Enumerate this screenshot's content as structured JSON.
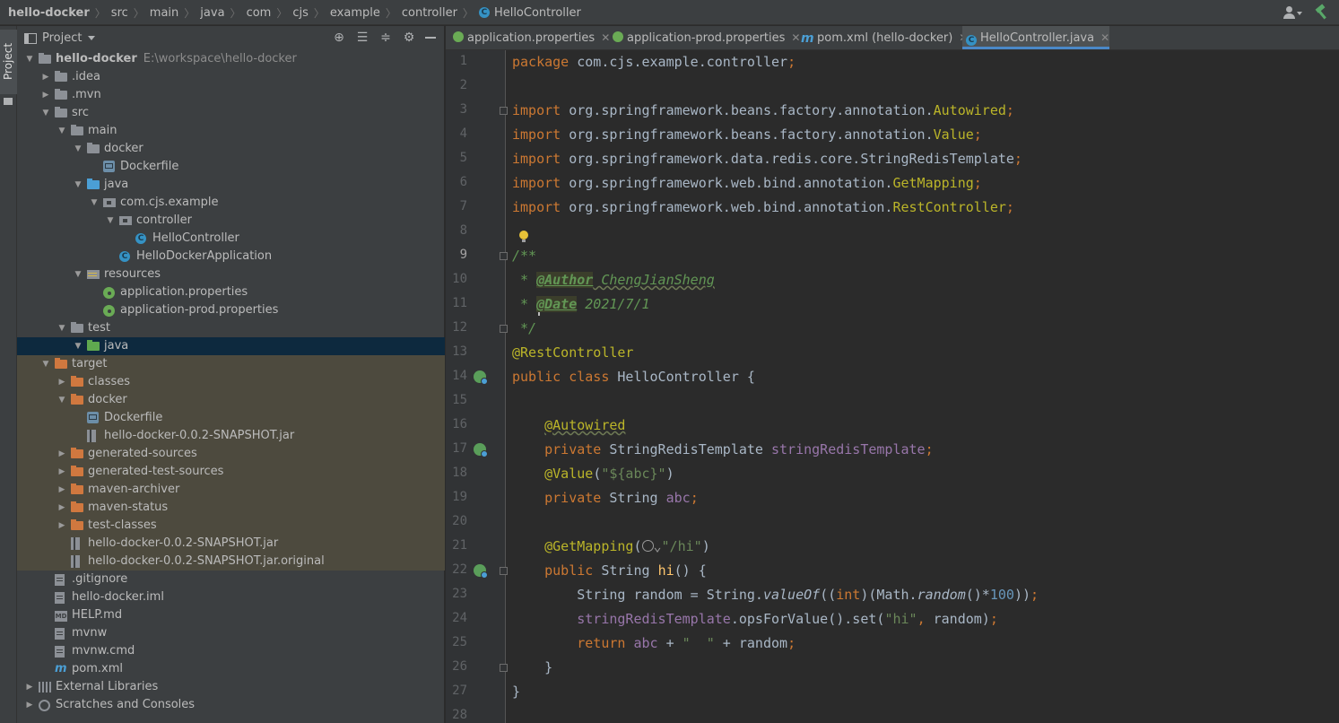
{
  "breadcrumbs": [
    "hello-docker",
    "src",
    "main",
    "java",
    "com",
    "cjs",
    "example",
    "controller",
    "HelloController"
  ],
  "project_panel": {
    "title": "Project"
  },
  "side_stripe": {
    "label": "Project"
  },
  "tree": [
    {
      "depth": 0,
      "arrow": "down",
      "icon": "folder",
      "label": "hello-docker",
      "path": "E:\\workspace\\hello-docker",
      "bold": true
    },
    {
      "depth": 1,
      "arrow": "right",
      "icon": "folder",
      "label": ".idea"
    },
    {
      "depth": 1,
      "arrow": "right",
      "icon": "folder",
      "label": ".mvn"
    },
    {
      "depth": 1,
      "arrow": "down",
      "icon": "folder",
      "label": "src"
    },
    {
      "depth": 2,
      "arrow": "down",
      "icon": "folder",
      "label": "main"
    },
    {
      "depth": 3,
      "arrow": "down",
      "icon": "folder",
      "label": "docker"
    },
    {
      "depth": 4,
      "arrow": "",
      "icon": "docker",
      "label": "Dockerfile"
    },
    {
      "depth": 3,
      "arrow": "down",
      "icon": "src",
      "label": "java"
    },
    {
      "depth": 4,
      "arrow": "down",
      "icon": "pkg",
      "label": "com.cjs.example"
    },
    {
      "depth": 5,
      "arrow": "down",
      "icon": "pkg",
      "label": "controller"
    },
    {
      "depth": 6,
      "arrow": "",
      "icon": "class",
      "label": "HelloController"
    },
    {
      "depth": 5,
      "arrow": "",
      "icon": "class",
      "label": "HelloDockerApplication"
    },
    {
      "depth": 3,
      "arrow": "down",
      "icon": "res",
      "label": "resources"
    },
    {
      "depth": 4,
      "arrow": "",
      "icon": "prop",
      "label": "application.properties"
    },
    {
      "depth": 4,
      "arrow": "",
      "icon": "prop",
      "label": "application-prod.properties"
    },
    {
      "depth": 2,
      "arrow": "down",
      "icon": "folder",
      "label": "test"
    },
    {
      "depth": 3,
      "arrow": "down",
      "icon": "test",
      "label": "java",
      "selected": true
    },
    {
      "depth": 1,
      "arrow": "down",
      "icon": "target",
      "label": "target",
      "excluded": true
    },
    {
      "depth": 2,
      "arrow": "right",
      "icon": "target",
      "label": "classes",
      "excluded": true
    },
    {
      "depth": 2,
      "arrow": "down",
      "icon": "target",
      "label": "docker",
      "excluded": true
    },
    {
      "depth": 3,
      "arrow": "",
      "icon": "docker",
      "label": "Dockerfile",
      "excluded": true
    },
    {
      "depth": 3,
      "arrow": "",
      "icon": "jar",
      "label": "hello-docker-0.0.2-SNAPSHOT.jar",
      "excluded": true
    },
    {
      "depth": 2,
      "arrow": "right",
      "icon": "target",
      "label": "generated-sources",
      "excluded": true
    },
    {
      "depth": 2,
      "arrow": "right",
      "icon": "target",
      "label": "generated-test-sources",
      "excluded": true
    },
    {
      "depth": 2,
      "arrow": "right",
      "icon": "target",
      "label": "maven-archiver",
      "excluded": true
    },
    {
      "depth": 2,
      "arrow": "right",
      "icon": "target",
      "label": "maven-status",
      "excluded": true
    },
    {
      "depth": 2,
      "arrow": "right",
      "icon": "target",
      "label": "test-classes",
      "excluded": true
    },
    {
      "depth": 2,
      "arrow": "",
      "icon": "jar",
      "label": "hello-docker-0.0.2-SNAPSHOT.jar",
      "excluded": true
    },
    {
      "depth": 2,
      "arrow": "",
      "icon": "jar",
      "label": "hello-docker-0.0.2-SNAPSHOT.jar.original",
      "excluded": true
    },
    {
      "depth": 1,
      "arrow": "",
      "icon": "file",
      "label": ".gitignore"
    },
    {
      "depth": 1,
      "arrow": "",
      "icon": "file",
      "label": "hello-docker.iml"
    },
    {
      "depth": 1,
      "arrow": "",
      "icon": "md",
      "label": "HELP.md"
    },
    {
      "depth": 1,
      "arrow": "",
      "icon": "file",
      "label": "mvnw"
    },
    {
      "depth": 1,
      "arrow": "",
      "icon": "file",
      "label": "mvnw.cmd"
    },
    {
      "depth": 1,
      "arrow": "",
      "icon": "maven",
      "label": "pom.xml"
    },
    {
      "depth": 0,
      "arrow": "right",
      "icon": "lib",
      "label": "External Libraries"
    },
    {
      "depth": 0,
      "arrow": "right",
      "icon": "scratch",
      "label": "Scratches and Consoles"
    }
  ],
  "tabs": [
    {
      "label": "application.properties",
      "icon": "prop",
      "active": false
    },
    {
      "label": "application-prod.properties",
      "icon": "prop",
      "active": false
    },
    {
      "label": "pom.xml (hello-docker)",
      "icon": "maven",
      "active": false
    },
    {
      "label": "HelloController.java",
      "icon": "class",
      "active": true
    }
  ],
  "editor": {
    "current_line": 9,
    "lines": [
      [
        [
          "kw",
          "package "
        ],
        [
          "",
          "com.cjs.example.controller"
        ],
        [
          "kw",
          ";"
        ]
      ],
      [],
      [
        [
          "kw",
          "import "
        ],
        [
          "",
          "org.springframework.beans.factory.annotation."
        ],
        [
          "ann",
          "Autowired"
        ],
        [
          "kw",
          ";"
        ]
      ],
      [
        [
          "kw",
          "import "
        ],
        [
          "",
          "org.springframework.beans.factory.annotation."
        ],
        [
          "ann",
          "Value"
        ],
        [
          "kw",
          ";"
        ]
      ],
      [
        [
          "kw",
          "import "
        ],
        [
          "",
          "org.springframework.data.redis.core.StringRedisTemplate"
        ],
        [
          "kw",
          ";"
        ]
      ],
      [
        [
          "kw",
          "import "
        ],
        [
          "",
          "org.springframework.web.bind.annotation."
        ],
        [
          "ann",
          "GetMapping"
        ],
        [
          "kw",
          ";"
        ]
      ],
      [
        [
          "kw",
          "import "
        ],
        [
          "",
          "org.springframework.web.bind.annotation."
        ],
        [
          "ann",
          "RestController"
        ],
        [
          "kw",
          ";"
        ]
      ],
      [],
      [
        [
          "cmt",
          "/**"
        ]
      ],
      [
        [
          "cmt",
          " * "
        ],
        [
          "cmt tag",
          "@Author"
        ],
        [
          "cmt sq",
          " ChengJianSheng"
        ]
      ],
      [
        [
          "cmt",
          " * "
        ],
        [
          "cmt tag",
          "@Date"
        ],
        [
          "cmt",
          " 2021/7/1"
        ]
      ],
      [
        [
          "cmt",
          " */"
        ]
      ],
      [
        [
          "ann",
          "@RestController"
        ]
      ],
      [
        [
          "kw",
          "public class "
        ],
        [
          "",
          "HelloController {"
        ]
      ],
      [],
      [
        [
          "",
          "    "
        ],
        [
          "ann sq",
          "@Autowired"
        ]
      ],
      [
        [
          "",
          "    "
        ],
        [
          "kw",
          "private "
        ],
        [
          "",
          "StringRedisTemplate "
        ],
        [
          "fld",
          "stringRedisTemplate"
        ],
        [
          "kw",
          ";"
        ]
      ],
      [
        [
          "",
          "    "
        ],
        [
          "ann",
          "@Value"
        ],
        [
          "",
          "("
        ],
        [
          "str",
          "\"${abc}\""
        ],
        [
          "",
          ")"
        ]
      ],
      [
        [
          "",
          "    "
        ],
        [
          "kw",
          "private "
        ],
        [
          "",
          "String "
        ],
        [
          "fld",
          "abc"
        ],
        [
          "kw",
          ";"
        ]
      ],
      [],
      [
        [
          "",
          "    "
        ],
        [
          "ann",
          "@GetMapping"
        ],
        [
          "",
          "("
        ],
        [
          "globe",
          "G"
        ],
        [
          "str",
          "\"/hi\""
        ],
        [
          "",
          ")"
        ]
      ],
      [
        [
          "",
          "    "
        ],
        [
          "kw",
          "public "
        ],
        [
          "",
          "String "
        ],
        [
          "fn",
          "hi"
        ],
        [
          "",
          "() {"
        ]
      ],
      [
        [
          "",
          "        String random = String."
        ],
        [
          "it",
          "valueOf"
        ],
        [
          "",
          "(("
        ],
        [
          "kw",
          "int"
        ],
        [
          "",
          ")(Math."
        ],
        [
          "it",
          "random"
        ],
        [
          "",
          "()*"
        ],
        [
          "num",
          "100"
        ],
        [
          "",
          "))"
        ],
        [
          "kw",
          ";"
        ]
      ],
      [
        [
          "",
          "        "
        ],
        [
          "fld",
          "stringRedisTemplate"
        ],
        [
          "",
          ".opsForValue().set("
        ],
        [
          "str",
          "\"hi\""
        ],
        [
          "kw",
          ", "
        ],
        [
          "",
          "random)"
        ],
        [
          "kw",
          ";"
        ]
      ],
      [
        [
          "",
          "        "
        ],
        [
          "kw",
          "return "
        ],
        [
          "fld",
          "abc"
        ],
        [
          "",
          " + "
        ],
        [
          "str",
          "\"  \""
        ],
        [
          "",
          " + random"
        ],
        [
          "kw",
          ";"
        ]
      ],
      [
        [
          "",
          "    }"
        ]
      ],
      [
        [
          "",
          "}"
        ]
      ],
      []
    ]
  }
}
